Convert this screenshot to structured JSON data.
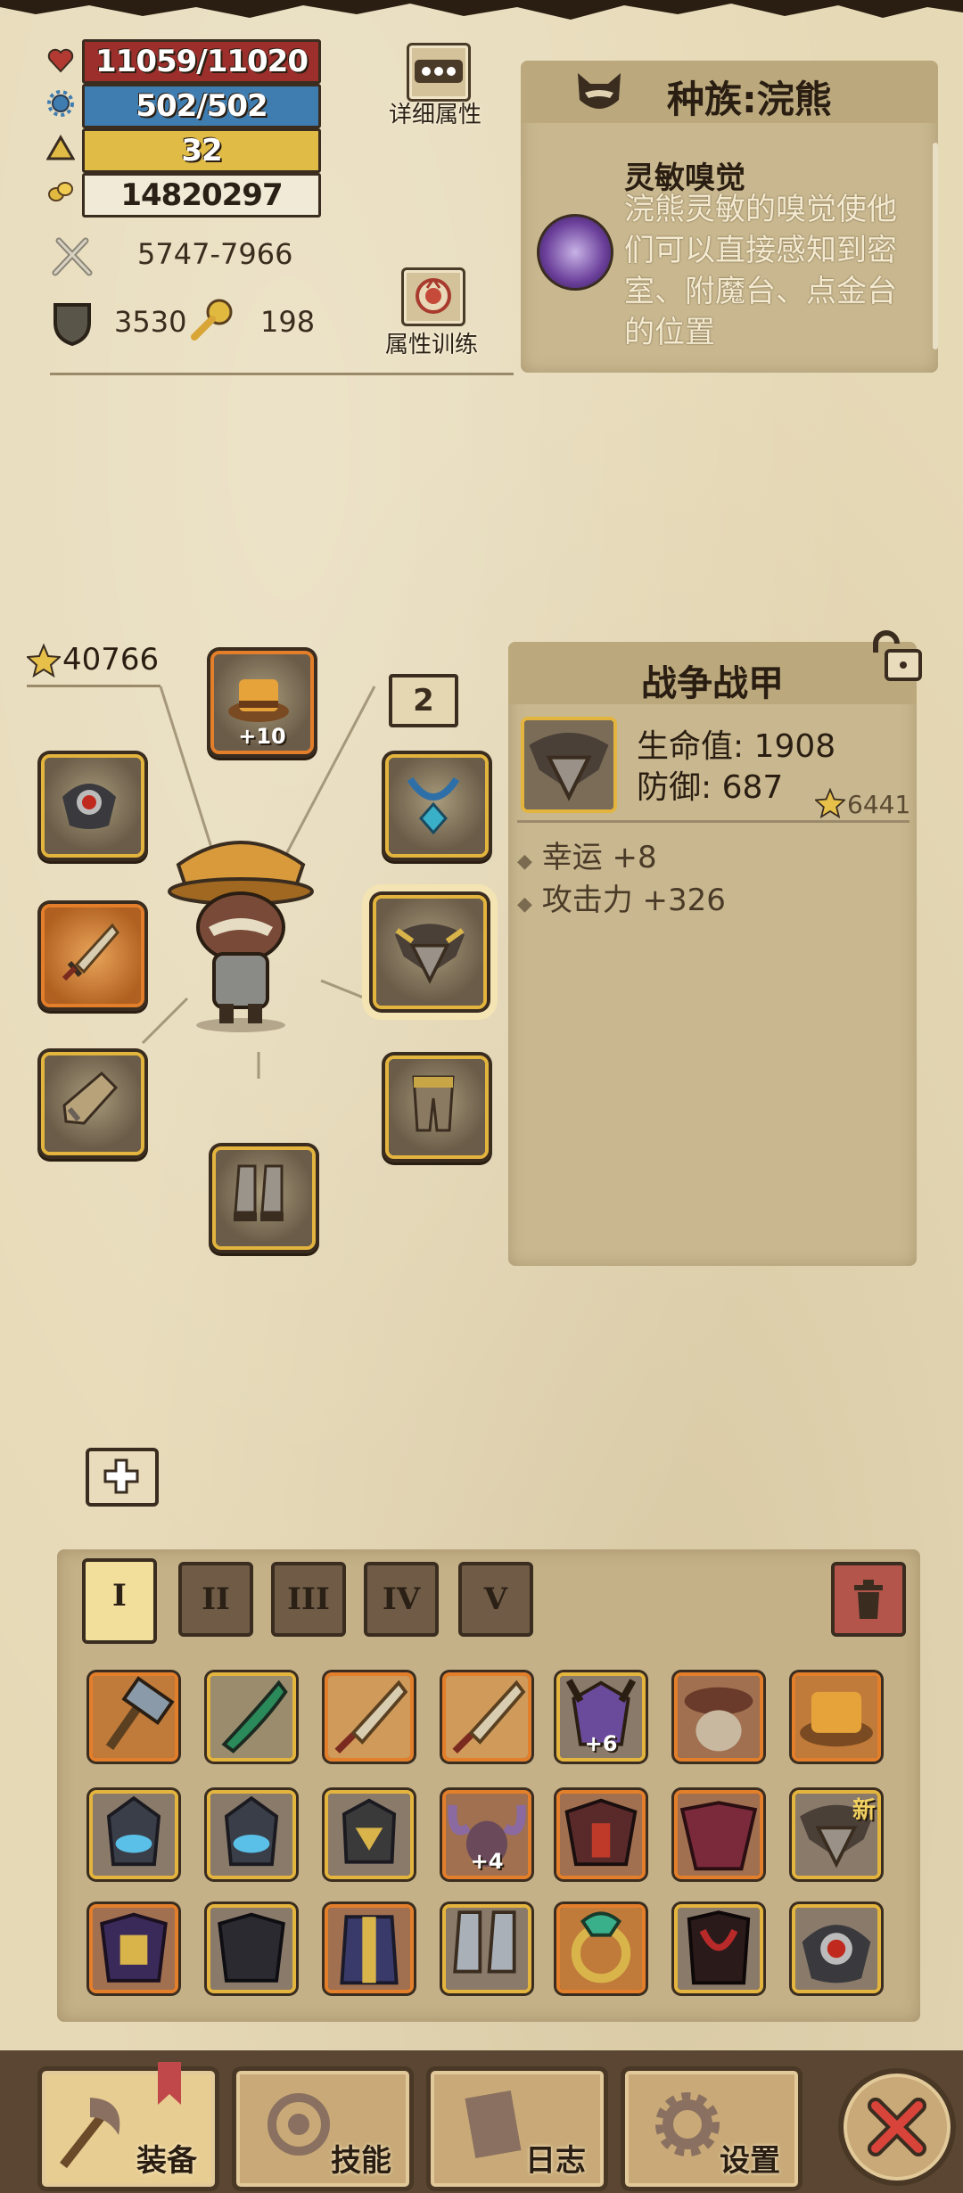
{
  "stats": {
    "hp": "11059/11020",
    "mp": "502/502",
    "level": "32",
    "gold": "14820297",
    "attack": "5747-7966",
    "defense": "3530",
    "bones": "198"
  },
  "buttons": {
    "detail_label": "详细属性",
    "train_label": "属性训练"
  },
  "race": {
    "title": "种族:浣熊",
    "skill_name": "灵敏嗅觉",
    "skill_desc_lines": [
      "浣熊灵敏的嗅觉使他",
      "们可以直接感知到密",
      "室、附魔台、点金台",
      "的位置"
    ]
  },
  "equipment": {
    "total_score": "40766",
    "helmet_plus": "+10",
    "set_count": "2"
  },
  "item_panel": {
    "name": "战争战甲",
    "stat1": "生命值: 1908",
    "stat2": "防御: 687",
    "score": "6441",
    "bonus1": "幸运 +8",
    "bonus2": "攻击力 +326",
    "bonus_bullet": "◆"
  },
  "tabs": [
    "I",
    "II",
    "III",
    "IV",
    "V"
  ],
  "inventory": {
    "row1_plus": "+6",
    "row2_plus": "+4",
    "new_badge": "新"
  },
  "nav": {
    "equip": "装备",
    "skills": "技能",
    "log": "日志",
    "settings": "设置"
  },
  "colors": {
    "hp": "#9c2f2c",
    "mp": "#3f7db0",
    "level": "#e0bb45",
    "gold_bar": "#f0ead6",
    "slot_gold": "#e3b43e",
    "slot_orange": "#e37f2b"
  }
}
